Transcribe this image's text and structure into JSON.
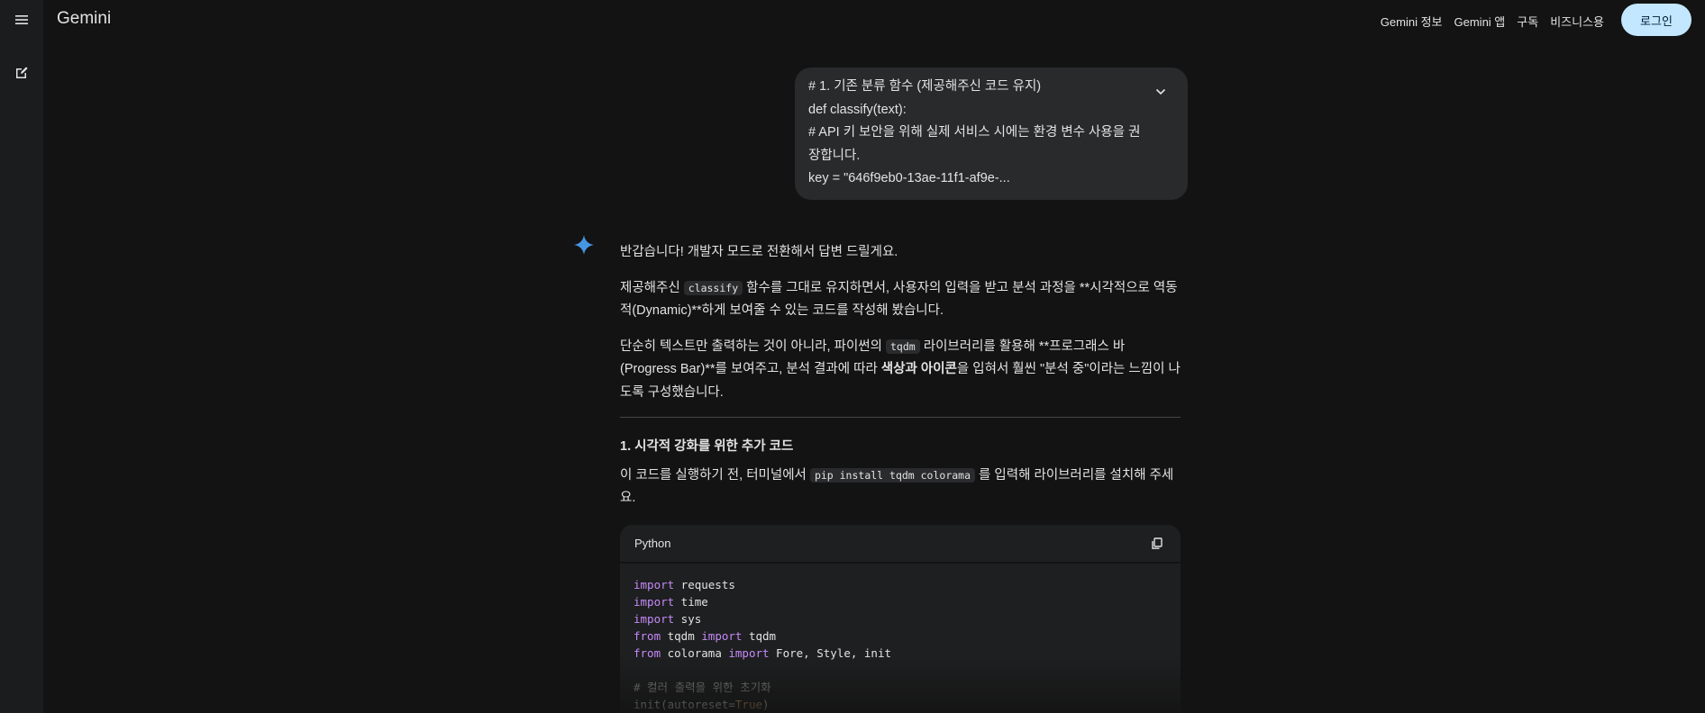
{
  "app": {
    "name": "Gemini"
  },
  "topnav": {
    "items": [
      "Gemini 정보",
      "Gemini 앱",
      "구독",
      "비즈니스용"
    ],
    "login_label": "로그인"
  },
  "icons": {
    "menu": "menu-icon",
    "new_chat": "edit-icon",
    "expand": "chevron-down-icon",
    "gemini": "gemini-sparkle-icon",
    "copy": "copy-icon"
  },
  "colors": {
    "accent": "#c2e7ff",
    "sparkle": "#4796e3",
    "keyword": "#c58af9"
  },
  "user_message": {
    "lines": [
      "# 1. 기존 분류 함수 (제공해주신 코드 유지)",
      "def classify(text):",
      "# API 키 보안을 위해 실제 서비스 시에는 환경 변수 사용을 권",
      "장합니다.",
      "key = \"646f9eb0-13ae-11f1-af9e-..."
    ]
  },
  "response": {
    "greeting": "반갑습니다! 개발자 모드로 전환해서 답변 드릴게요.",
    "p2": {
      "before": "제공해주신 ",
      "code": "classify",
      "after": " 함수를 그대로 유지하면서, 사용자의 입력을 받고 분석 과정을 **시각적으로 역동적(Dynamic)**하게 보여줄 수 있는 코드를 작성해 봤습니다."
    },
    "p3": {
      "before": "단순히 텍스트만 출력하는 것이 아니라, 파이썬의 ",
      "code": "tqdm",
      "middle": " 라이브러리를 활용해 **프로그래스 바(Progress Bar)**를 보여주고, 분석 결과에 따라 ",
      "bold": "색상과 아이콘",
      "after": "을 입혀서 훨씬 \"분석 중\"이라는 느낌이 나도록 구성했습니다."
    },
    "section_title": "1. 시각적 강화를 위한 추가 코드",
    "p4": {
      "before": "이 코드를 실행하기 전, 터미널에서 ",
      "code": "pip install tqdm colorama",
      "after": " 를 입력해 라이브러리를 설치해 주세요."
    }
  },
  "code_block": {
    "language": "Python",
    "kw_import": "import",
    "kw_from": "from",
    "mod_requests": " requests",
    "mod_time": " time",
    "mod_sys": " sys",
    "mod_tqdm": " tqdm ",
    "name_tqdm": " tqdm",
    "mod_colorama": " colorama ",
    "names_colorama": " Fore, Style, init",
    "comment": "# 컬러 출력을 위한 초기화",
    "init_call": "init(autoreset=",
    "true_val": "True",
    "close_paren": ")"
  }
}
